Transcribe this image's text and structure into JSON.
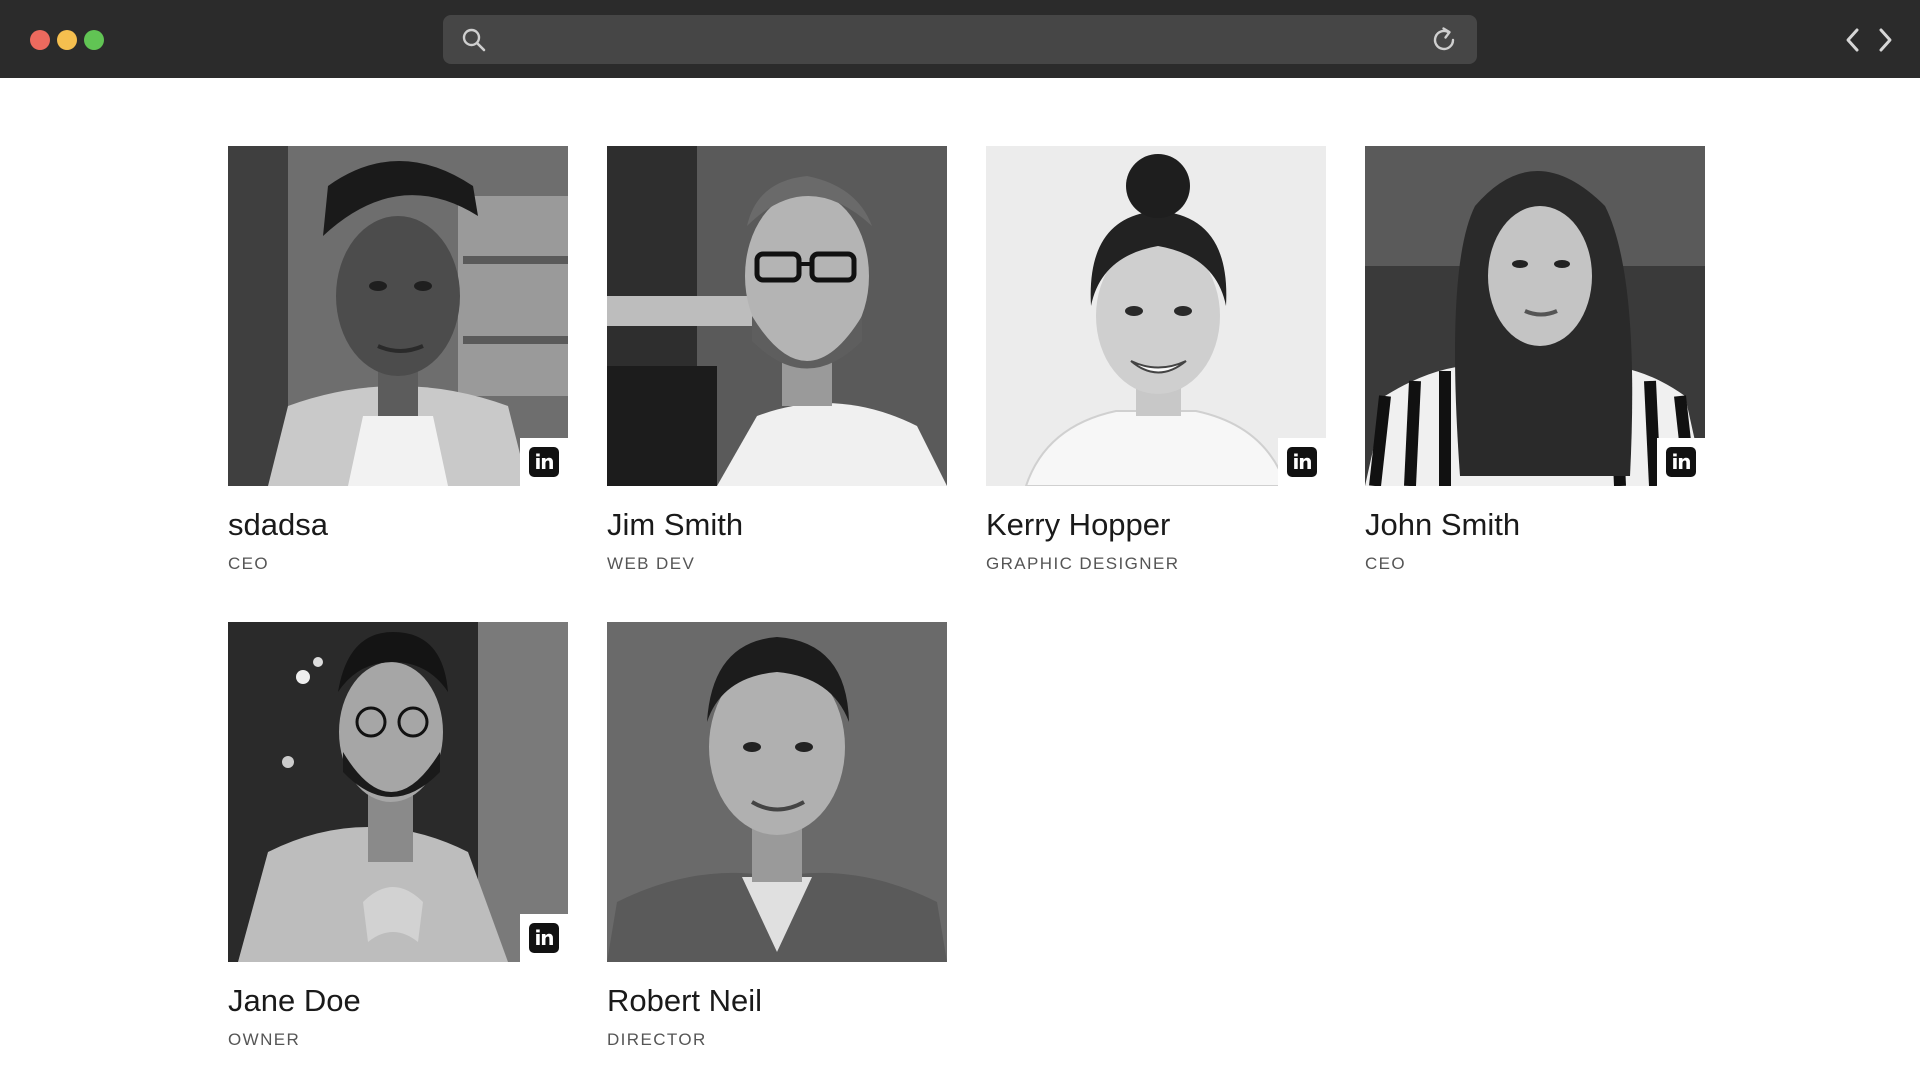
{
  "browser": {
    "search_icon": "search-icon",
    "reload_icon": "reload-icon",
    "back_icon": "chevron-left-icon",
    "forward_icon": "chevron-right-icon",
    "traffic_colors": [
      "#ed6a5e",
      "#f5bf4f",
      "#61c454"
    ]
  },
  "team": {
    "members": [
      {
        "name": "sdadsa",
        "role": "CEO",
        "linkedin": true,
        "linkedin_label": "in"
      },
      {
        "name": "Jim Smith",
        "role": "WEB DEV",
        "linkedin": false,
        "linkedin_label": ""
      },
      {
        "name": "Kerry Hopper",
        "role": "GRAPHIC DESIGNER",
        "linkedin": true,
        "linkedin_label": "in"
      },
      {
        "name": "John Smith",
        "role": "CEO",
        "linkedin": true,
        "linkedin_label": "in"
      },
      {
        "name": "Jane Doe",
        "role": "OWNER",
        "linkedin": true,
        "linkedin_label": "in"
      },
      {
        "name": "Robert Neil",
        "role": "DIRECTOR",
        "linkedin": false,
        "linkedin_label": ""
      }
    ]
  }
}
